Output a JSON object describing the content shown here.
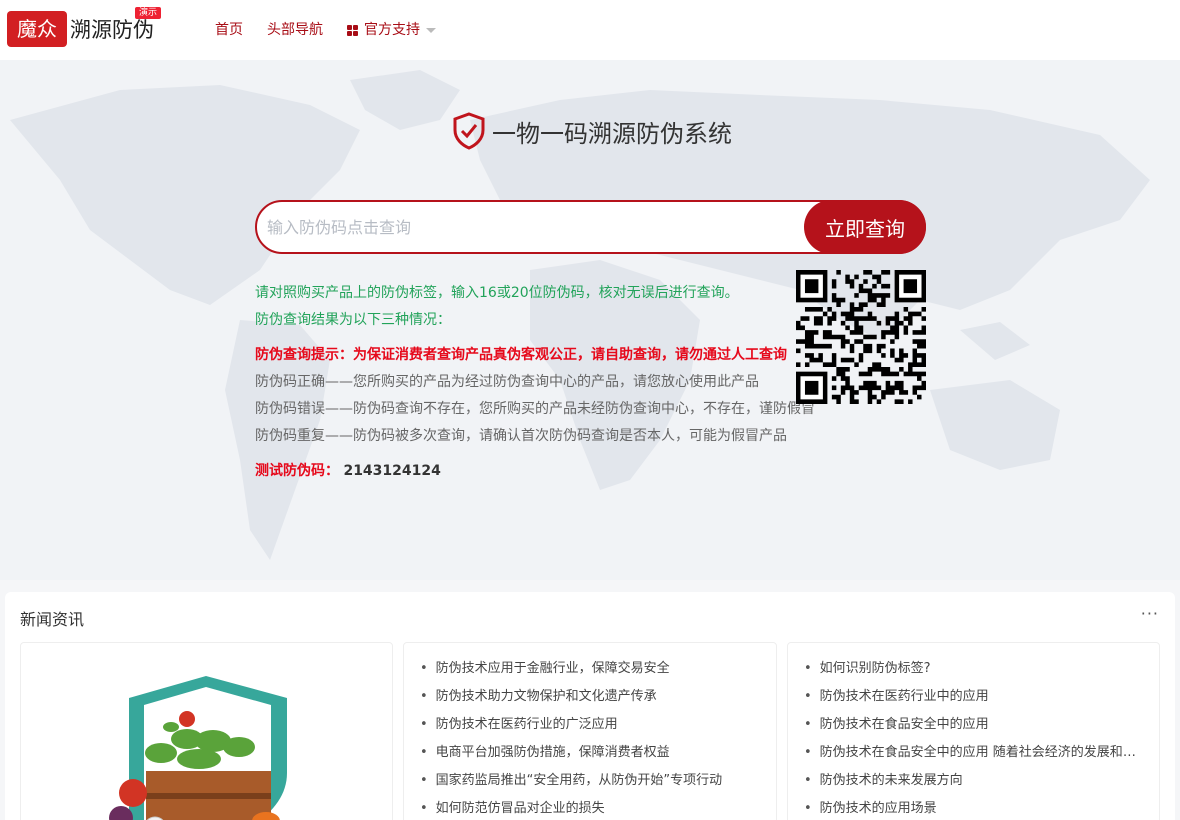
{
  "header": {
    "logo_mark": "魔众",
    "logo_text": "溯源防伪",
    "badge": "演示",
    "nav": [
      {
        "label": "首页"
      },
      {
        "label": "头部导航"
      },
      {
        "label": "官方支持",
        "icon": "grid-icon",
        "dropdown": true
      }
    ]
  },
  "hero": {
    "title": "一物一码溯源防伪系统",
    "title_icon": "shield-check-icon",
    "search": {
      "placeholder": "输入防伪码点击查询",
      "value": "",
      "button": "立即查询"
    },
    "instructions": [
      "请对照购买产品上的防伪标签，输入16或20位防伪码，核对无误后进行查询。",
      "防伪查询结果为以下三种情况："
    ],
    "notice": "防伪查询提示：为保证消费者查询产品真伪客观公正，请自助查询，请勿通过人工查询",
    "results": [
      "防伪码正确——您所购买的产品为经过防伪查询中心的产品，请您放心使用此产品",
      "防伪码错误——防伪码查询不存在，您所购买的产品未经防伪查询中心，不存在，谨防假冒",
      "防伪码重复——防伪码被多次查询，请确认首次防伪码查询是否本人，可能为假冒产品"
    ],
    "test_label": "测试防伪码：",
    "test_code": "2143124124",
    "qr_icon": "qr-code-icon"
  },
  "news": {
    "title": "新闻资讯",
    "more": "···",
    "col_a": [
      "防伪技术应用于金融行业，保障交易安全",
      "防伪技术助力文物保护和文化遗产传承",
      "防伪技术在医药行业的广泛应用",
      "电商平台加强防伪措施，保障消费者权益",
      "国家药监局推出“安全用药，从防伪开始”专项行动",
      "如何防范仿冒品对企业的损失"
    ],
    "col_b": [
      "如何识别防伪标签?",
      "防伪技术在医药行业中的应用",
      "防伪技术在食品安全中的应用",
      "防伪技术在食品安全中的应用 随着社会经济的发展和人民生活水平的提高",
      "防伪技术的未来发展方向",
      "防伪技术的应用场景"
    ]
  },
  "colors": {
    "brand": "#b5121b",
    "logo": "#d21f22",
    "green": "#22a35a",
    "red": "#e6091b"
  }
}
